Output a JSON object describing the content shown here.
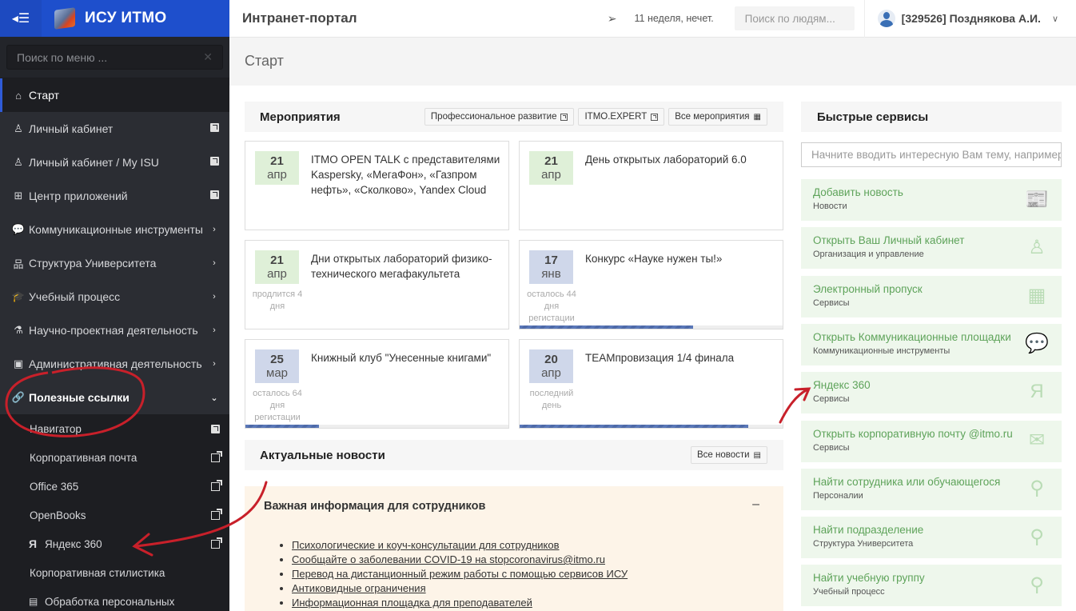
{
  "brand": {
    "name": "ИСУ ИТМО",
    "toggle_icon": "menu-collapse-icon"
  },
  "menu_search": {
    "placeholder": "Поиск по меню ...",
    "clear": "✕"
  },
  "nav": [
    {
      "label": "Старт",
      "icon": "home-icon",
      "glyph": "⌂",
      "right": "",
      "state": "active"
    },
    {
      "label": "Личный кабинет",
      "icon": "user-icon",
      "glyph": "♙",
      "right": "external",
      "state": ""
    },
    {
      "label": "Личный кабинет / My ISU",
      "icon": "user-icon",
      "glyph": "♙",
      "right": "external",
      "state": ""
    },
    {
      "label": "Центр приложений",
      "icon": "grid-icon",
      "glyph": "⊞",
      "right": "external",
      "state": ""
    },
    {
      "label": "Коммуникационные инструменты",
      "icon": "chat-icon",
      "glyph": "💬",
      "right": "chevron",
      "state": ""
    },
    {
      "label": "Структура Университета",
      "icon": "sitemap-icon",
      "glyph": "品",
      "right": "chevron",
      "state": ""
    },
    {
      "label": "Учебный процесс",
      "icon": "graduation-cap-icon",
      "glyph": "🎓",
      "right": "chevron",
      "state": ""
    },
    {
      "label": "Научно-проектная деятельность",
      "icon": "flask-icon",
      "glyph": "⚗",
      "right": "chevron",
      "state": ""
    },
    {
      "label": "Административная деятельность",
      "icon": "briefcase-icon",
      "glyph": "▣",
      "right": "chevron",
      "state": ""
    },
    {
      "label": "Полезные ссылки",
      "icon": "link-icon",
      "glyph": "🔗",
      "right": "chevron-down",
      "state": "open"
    }
  ],
  "submenu": [
    {
      "label": "Навигатор",
      "right": "external"
    },
    {
      "label": "Корпоративная почта",
      "right": "external-out"
    },
    {
      "label": "Office 365",
      "right": "external-out"
    },
    {
      "label": "OpenBooks",
      "right": "external-out"
    },
    {
      "label": "Яндекс 360",
      "prefix": "Я",
      "right": "external-out"
    },
    {
      "label": "Корпоративная стилистика",
      "right": ""
    },
    {
      "label": "Обработка персональных",
      "prefix": "▤",
      "right": ""
    }
  ],
  "topbar": {
    "title": "Интранет-портал",
    "week": "11 неделя, нечет.",
    "people_search_placeholder": "Поиск по людям...",
    "user": "[329526] Позднякова А.И."
  },
  "page": {
    "title": "Старт"
  },
  "events_panel": {
    "title": "Мероприятия",
    "buttons": [
      "Профессиональное развитие",
      "ITMO.EXPERT",
      "Все мероприятия"
    ],
    "events": [
      {
        "day": "21",
        "month": "апр",
        "color": "green",
        "title": "ITMO OPEN TALK с представителями Kaspersky, «МегаФон», «Газпром нефть», «Сколково», Yandex Cloud",
        "note": "",
        "progress": null
      },
      {
        "day": "21",
        "month": "апр",
        "color": "green",
        "title": "День открытых лабораторий 6.0",
        "note": "",
        "progress": null
      },
      {
        "day": "21",
        "month": "апр",
        "color": "green",
        "title": "Дни открытых лабораторий физико-технического мегафакультета",
        "note": "продлится 4 дня",
        "progress": null
      },
      {
        "day": "17",
        "month": "янв",
        "color": "blue",
        "title": "Конкурс «Науке нужен ты!»",
        "note": "осталось 44 дня регистации",
        "progress": 0.66
      },
      {
        "day": "25",
        "month": "мар",
        "color": "blue",
        "title": "Книжный клуб \"Унесенные книгами\"",
        "note": "осталось 64 дня регистации",
        "progress": 0.28
      },
      {
        "day": "20",
        "month": "апр",
        "color": "blue",
        "title": "TEAMпровизация 1/4 финала",
        "note": "последний день",
        "progress": 0.87
      }
    ]
  },
  "news_panel": {
    "title": "Актуальные новости",
    "all_button": "Все новости",
    "important": {
      "title": "Важная информация для сотрудников",
      "collapse": "–",
      "links": [
        "Психологические и коуч-консультации для сотрудников",
        "Сообщайте о заболевании COVID-19 на stopcoronavirus@itmo.ru",
        "Перевод на дистанционный режим работы с помощью сервисов ИСУ",
        "Антиковидные ограничения",
        "Информационная площадка для преподавателей"
      ]
    }
  },
  "quick_services": {
    "title": "Быстрые сервисы",
    "search_placeholder": "Начните вводить интересную Вам тему, например",
    "items": [
      {
        "title": "Добавить новость",
        "sub": "Новости",
        "icon": "newspaper-icon",
        "glyph": "📰"
      },
      {
        "title": "Открыть Ваш Личный кабинет",
        "sub": "Организация и управление",
        "icon": "user-icon",
        "glyph": "♙"
      },
      {
        "title": "Электронный пропуск",
        "sub": "Сервисы",
        "icon": "qr-code-icon",
        "glyph": "▦"
      },
      {
        "title": "Открыть Коммуникационные площадки",
        "sub": "Коммуникационные инструменты",
        "icon": "chat-icon",
        "glyph": "💬"
      },
      {
        "title": "Яндекс 360",
        "sub": "Сервисы",
        "icon": "yandex-icon",
        "glyph": "Я"
      },
      {
        "title": "Открыть корпоративную почту @itmo.ru",
        "sub": "Сервисы",
        "icon": "envelope-icon",
        "glyph": "✉"
      },
      {
        "title": "Найти сотрудника или обучающегося",
        "sub": "Персоналии",
        "icon": "search-icon",
        "glyph": "⚲"
      },
      {
        "title": "Найти подразделение",
        "sub": "Структура Университета",
        "icon": "search-icon",
        "glyph": "⚲"
      },
      {
        "title": "Найти учебную группу",
        "sub": "Учебный процесс",
        "icon": "search-icon",
        "glyph": "⚲"
      }
    ]
  },
  "colors": {
    "brand_blue": "#1e4fcc",
    "sidebar_bg": "#2b2d33",
    "event_green": "#dff0d8",
    "event_blue": "#cfd7ea",
    "service_green": "#5ea35a",
    "annotation_red": "#c8202a"
  }
}
